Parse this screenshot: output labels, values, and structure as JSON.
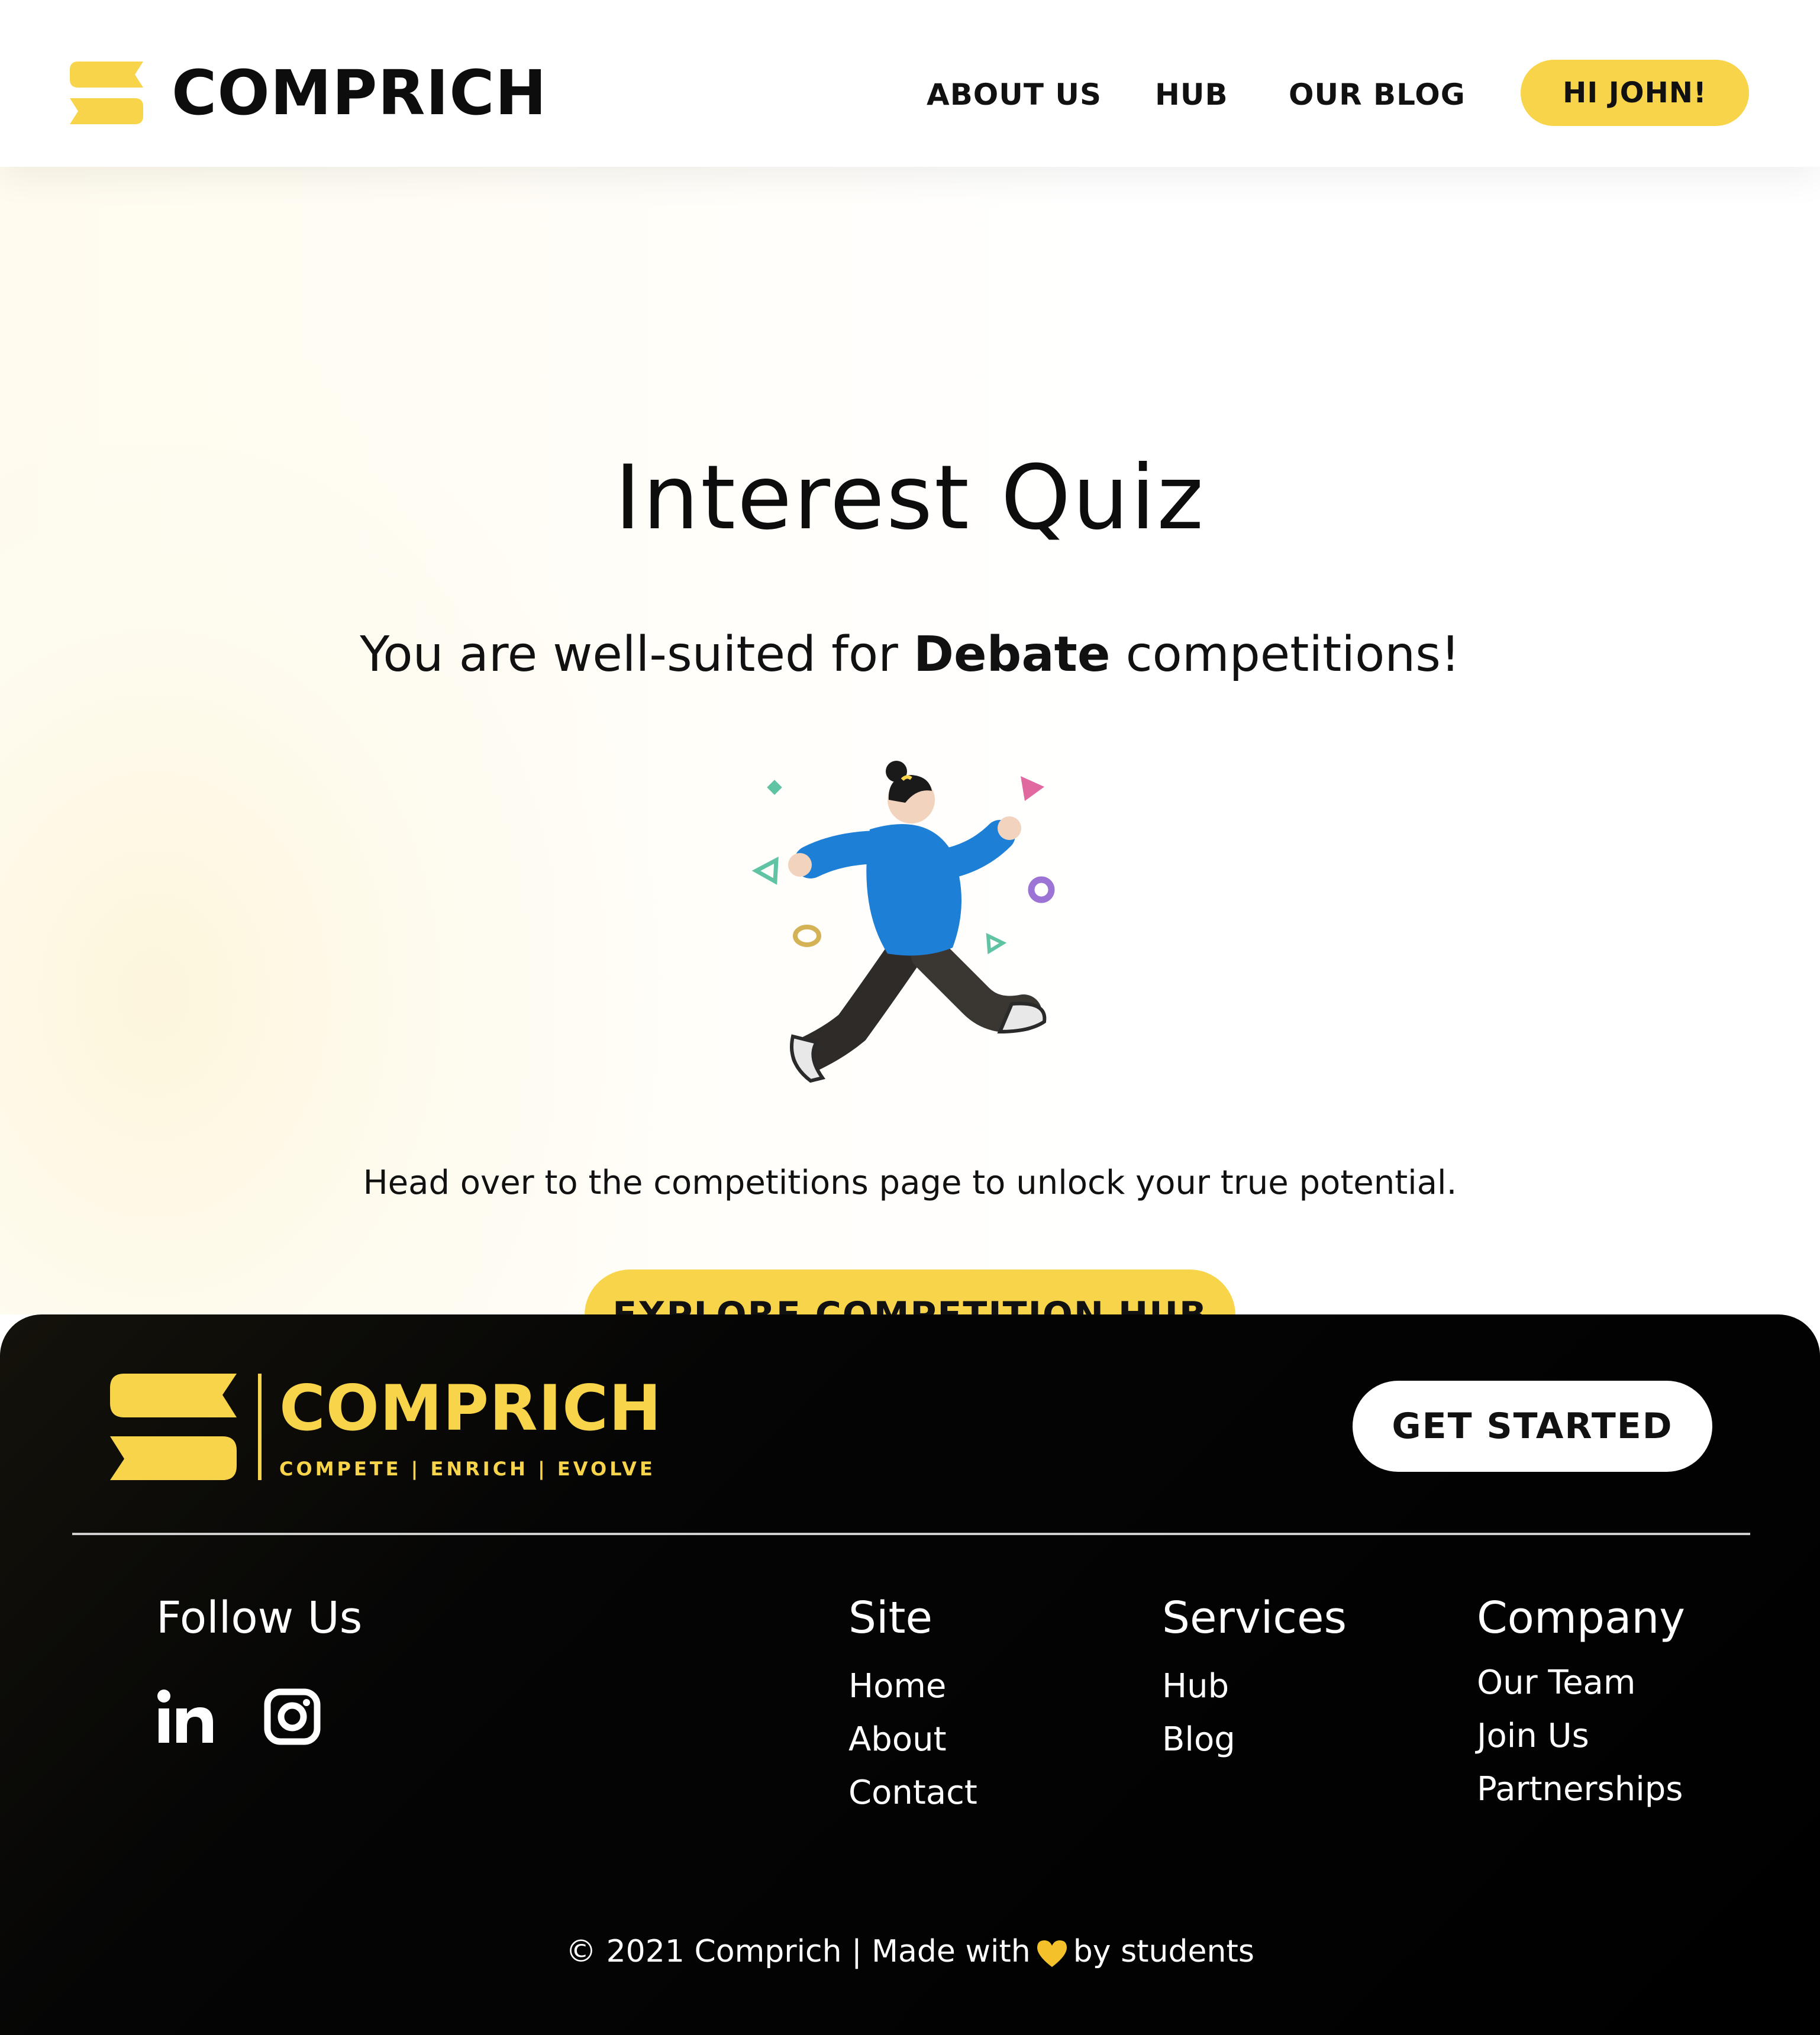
{
  "header": {
    "brand": "COMPRICH",
    "nav": [
      {
        "label": "ABOUT US"
      },
      {
        "label": "HUB"
      },
      {
        "label": "OUR BLOG"
      }
    ],
    "user_button": "HI JOHN!"
  },
  "main": {
    "title": "Interest Quiz",
    "result_prefix": "You are well-suited for ",
    "result_highlight": "Debate",
    "result_suffix": " competitions!",
    "cta_text": "Head over to the competitions page to unlock your true potential.",
    "cta_button": "EXPLORE COMPETITION HUB"
  },
  "footer": {
    "brand": "COMPRICH",
    "tagline": "COMPETE | ENRICH | EVOLVE",
    "get_started": "GET STARTED",
    "follow_heading": "Follow Us",
    "social": [
      {
        "icon": "linkedin-icon"
      },
      {
        "icon": "instagram-icon"
      }
    ],
    "columns": [
      {
        "heading": "Site",
        "links": [
          "Home",
          "About",
          "Contact"
        ]
      },
      {
        "heading": "Services",
        "links": [
          "Hub",
          "Blog"
        ]
      },
      {
        "heading": "Company",
        "links": [
          "Our Team",
          "Join Us",
          "Partnerships"
        ]
      }
    ],
    "copyright_prefix": "© 2021 Comprich | Made with",
    "copyright_suffix": "by students"
  },
  "colors": {
    "accent": "#f7d449",
    "footer_bg": "#000000",
    "text": "#111111"
  }
}
